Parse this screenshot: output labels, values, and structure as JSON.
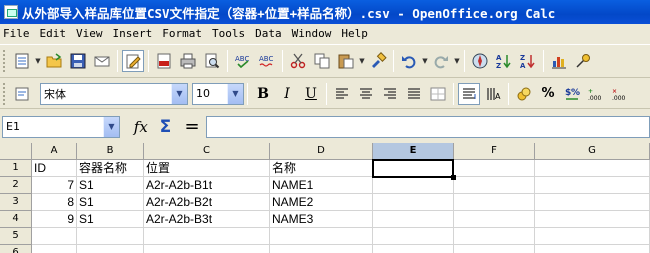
{
  "window": {
    "title": "从外部导入样品库位置CSV文件指定（容器+位置+样品名称）.csv - OpenOffice.org Calc"
  },
  "menu": [
    "File",
    "Edit",
    "View",
    "Insert",
    "Format",
    "Tools",
    "Data",
    "Window",
    "Help"
  ],
  "toolbar": {
    "font_name": "宋体",
    "font_size": "10"
  },
  "formula_bar": {
    "name_box": "E1",
    "fx": "𝑓x",
    "sigma": "Σ",
    "equals": "=",
    "content": ""
  },
  "sheet": {
    "columns": [
      "A",
      "B",
      "C",
      "D",
      "E",
      "F",
      "G"
    ],
    "selected_column": "E",
    "rows": [
      "1",
      "2",
      "3",
      "4",
      "5",
      "6"
    ],
    "cells": [
      [
        "ID",
        "容器名称",
        "位置",
        "名称",
        "",
        "",
        ""
      ],
      [
        "7",
        "S1",
        "A2r-A2b-B1t",
        "NAME1",
        "",
        "",
        ""
      ],
      [
        "8",
        "S1",
        "A2r-A2b-B2t",
        "NAME2",
        "",
        "",
        ""
      ],
      [
        "9",
        "S1",
        "A2r-A2b-B3t",
        "NAME3",
        "",
        "",
        ""
      ],
      [
        "",
        "",
        "",
        "",
        "",
        "",
        ""
      ],
      [
        "",
        "",
        "",
        "",
        "",
        "",
        ""
      ]
    ]
  },
  "colors": {
    "title_bar": "#0a5fe0",
    "selected_header": "#b4c7e0"
  }
}
